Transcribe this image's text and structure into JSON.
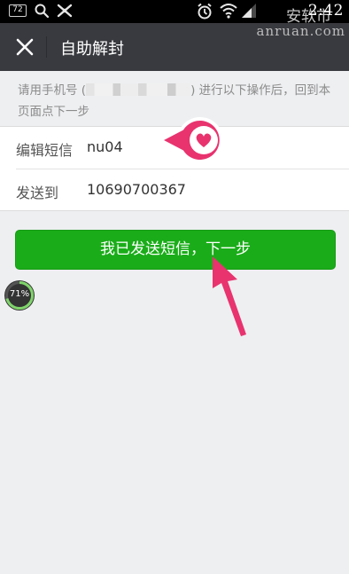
{
  "status_bar": {
    "badge": "72",
    "time": "2:42",
    "watermark_cn": "安软市",
    "watermark_en": "anruan.com",
    "icons": [
      "search-icon",
      "app-icon",
      "alarm-icon",
      "wifi-icon",
      "signal-icon"
    ]
  },
  "header": {
    "close_icon": "close-icon",
    "title": "自助解封"
  },
  "tip": {
    "prefix": "请用手机号 (",
    "suffix": ") 进行以下操作后，回到本页面点下一步"
  },
  "form": {
    "message": {
      "label": "编辑短信",
      "value": "nu04"
    },
    "send_to": {
      "label": "发送到",
      "value": "10690700367"
    }
  },
  "primary_button": {
    "label": "我已发送短信，下一步"
  },
  "progress": {
    "text": "71%",
    "value": 0.71
  },
  "annotations": {
    "heart_icon": "heart-icon",
    "arrow_icon": "arrow-up-icon",
    "accent": "#e8336f",
    "button_color": "#1aad19"
  }
}
